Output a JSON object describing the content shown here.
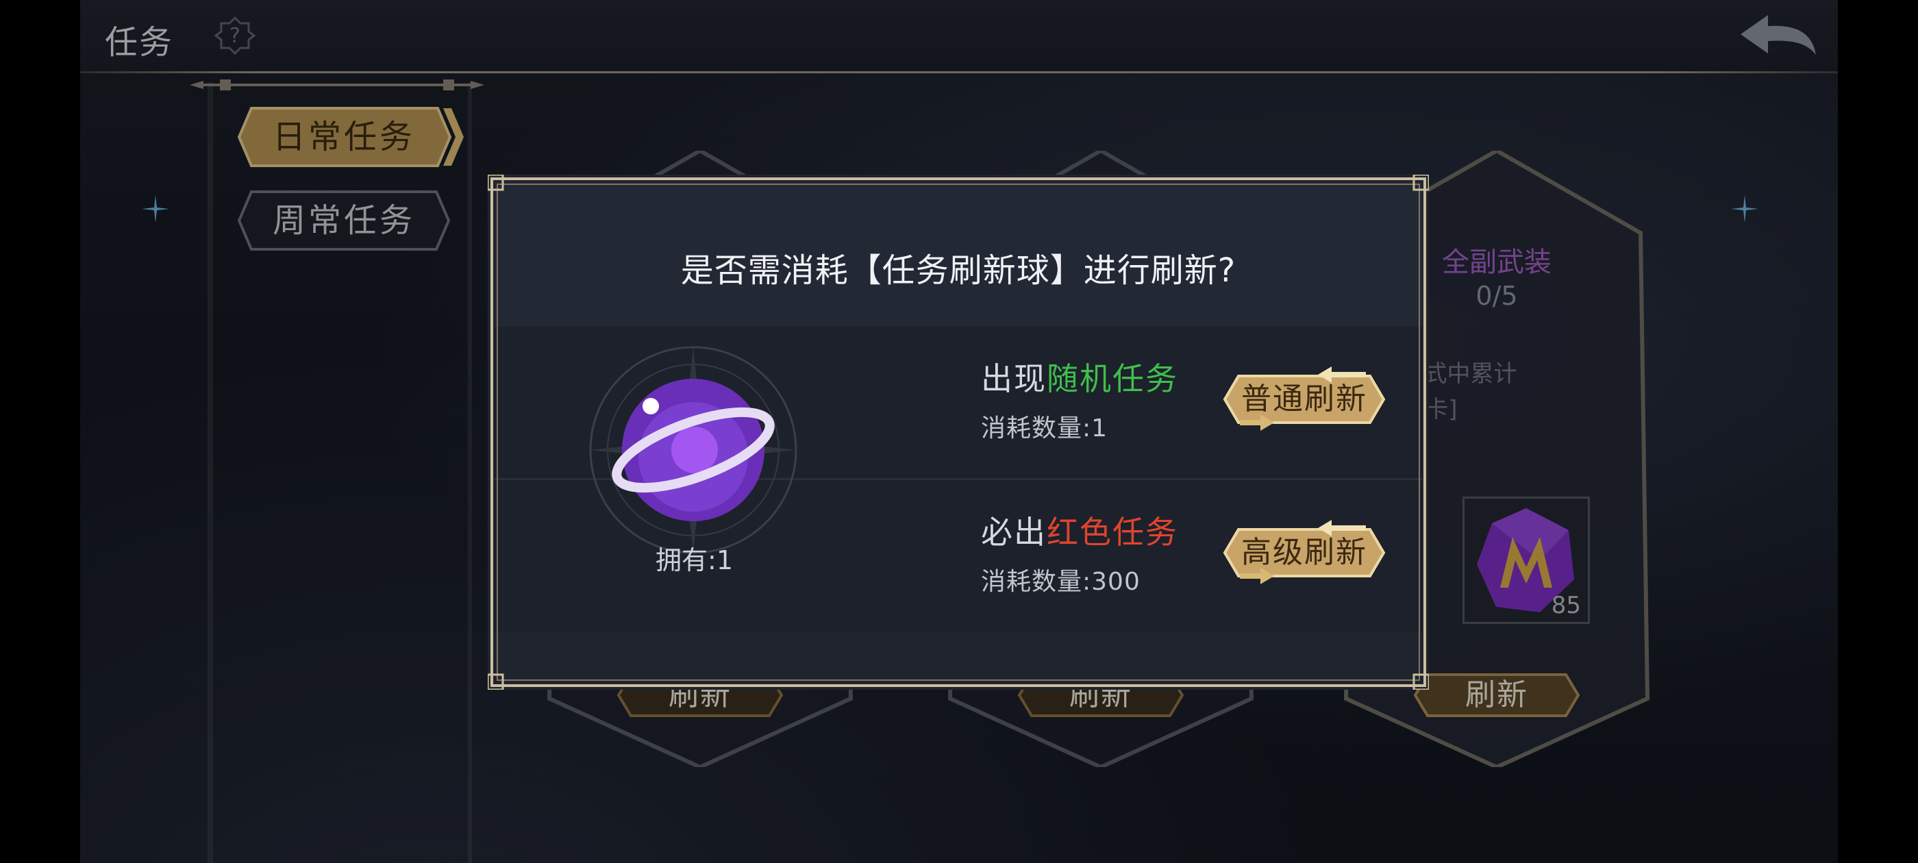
{
  "header": {
    "title": "任务"
  },
  "tabs": [
    {
      "label": "日常任务",
      "active": true
    },
    {
      "label": "周常任务",
      "active": false
    }
  ],
  "cards": [
    {
      "title": "",
      "progress": "",
      "button": "刷新"
    },
    {
      "title": "",
      "progress": "",
      "button": "刷新"
    },
    {
      "title": "全副武装",
      "progress": "0/5",
      "description": "/梦魇模式中累计\n张[装备卡]",
      "reward_count": "85",
      "button": "刷新"
    }
  ],
  "dialog": {
    "question": "是否需消耗【任务刷新球】进行刷新?",
    "owned_label": "拥有:",
    "owned_value": "1",
    "options": [
      {
        "prefix": "出现",
        "highlight": "随机任务",
        "highlight_color": "#3fbe4b",
        "cost_label": "消耗数量:",
        "cost_value": "1",
        "button": "普通刷新"
      },
      {
        "prefix": "必出",
        "highlight": "红色任务",
        "highlight_color": "#e0442f",
        "cost_label": "消耗数量:",
        "cost_value": "300",
        "button": "高级刷新"
      }
    ]
  },
  "colors": {
    "gold": "#c9a566",
    "purple": "#7a2fc0",
    "frame": "#9a917f"
  }
}
